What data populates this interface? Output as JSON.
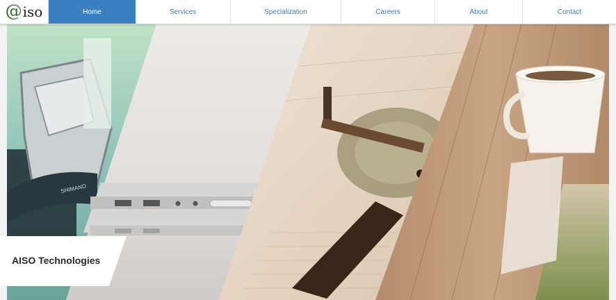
{
  "logo": {
    "symbol": "@",
    "text": "iso"
  },
  "nav": {
    "items": [
      {
        "label": "Home",
        "active": true
      },
      {
        "label": "Services",
        "active": false
      },
      {
        "label": "Specialization",
        "active": false
      },
      {
        "label": "Careers",
        "active": false
      },
      {
        "label": "About",
        "active": false
      },
      {
        "label": "Contact",
        "active": false
      }
    ]
  },
  "hero": {
    "caption": "AISO Technologies",
    "panels": [
      "bicycle-derailleur-photo",
      "laptop-ports-photo",
      "drafting-tools-photo",
      "coffee-cup-on-wood-photo"
    ]
  },
  "colors": {
    "accent": "#3a7fc0",
    "logo_green": "#2d6a1f",
    "nav_text": "#3a7bbf"
  }
}
